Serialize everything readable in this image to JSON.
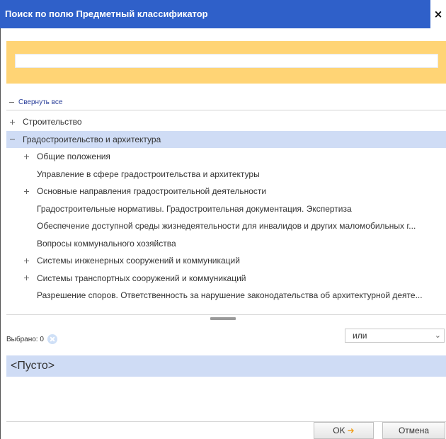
{
  "dialog": {
    "title": "Поиск по полю Предметный классификатор",
    "close_label": "×"
  },
  "search": {
    "value": "",
    "placeholder": ""
  },
  "collapse_all_label": "Свернуть все",
  "tree": {
    "items": [
      {
        "label": "Строительство",
        "level": 0,
        "toggle": "plus",
        "selected": false
      },
      {
        "label": "Градостроительство и архитектура",
        "level": 0,
        "toggle": "minus",
        "selected": true
      },
      {
        "label": "Общие положения",
        "level": 1,
        "toggle": "plus",
        "selected": false
      },
      {
        "label": "Управление в сфере градостроительства и архитектуры",
        "level": 1,
        "toggle": "none",
        "selected": false
      },
      {
        "label": "Основные направления градостроительной деятельности",
        "level": 1,
        "toggle": "plus",
        "selected": false
      },
      {
        "label": "Градостроительные нормативы. Градостроительная документация. Экспертиза",
        "level": 1,
        "toggle": "none",
        "selected": false
      },
      {
        "label": "Обеспечение доступной среды жизнедеятельности для инвалидов и других маломобильных г...",
        "level": 1,
        "toggle": "none",
        "selected": false
      },
      {
        "label": "Вопросы коммунального хозяйства",
        "level": 1,
        "toggle": "none",
        "selected": false
      },
      {
        "label": "Системы инженерных сооружений и коммуникаций",
        "level": 1,
        "toggle": "plus",
        "selected": false
      },
      {
        "label": "Системы транспортных сооружений и коммуникаций",
        "level": 1,
        "toggle": "plus",
        "selected": false
      },
      {
        "label": "Разрешение споров. Ответственность за нарушение законодательства об архитектурной деяте...",
        "level": 1,
        "toggle": "none",
        "selected": false
      }
    ]
  },
  "selection": {
    "label": "Выбрано: 0",
    "operator": "или",
    "empty_text": "<Пусто>"
  },
  "buttons": {
    "ok": "OK",
    "cancel": "Отмена"
  },
  "colors": {
    "titlebar": "#2f60c9",
    "search_band": "#ffd475",
    "selection": "#cfdcf5"
  }
}
